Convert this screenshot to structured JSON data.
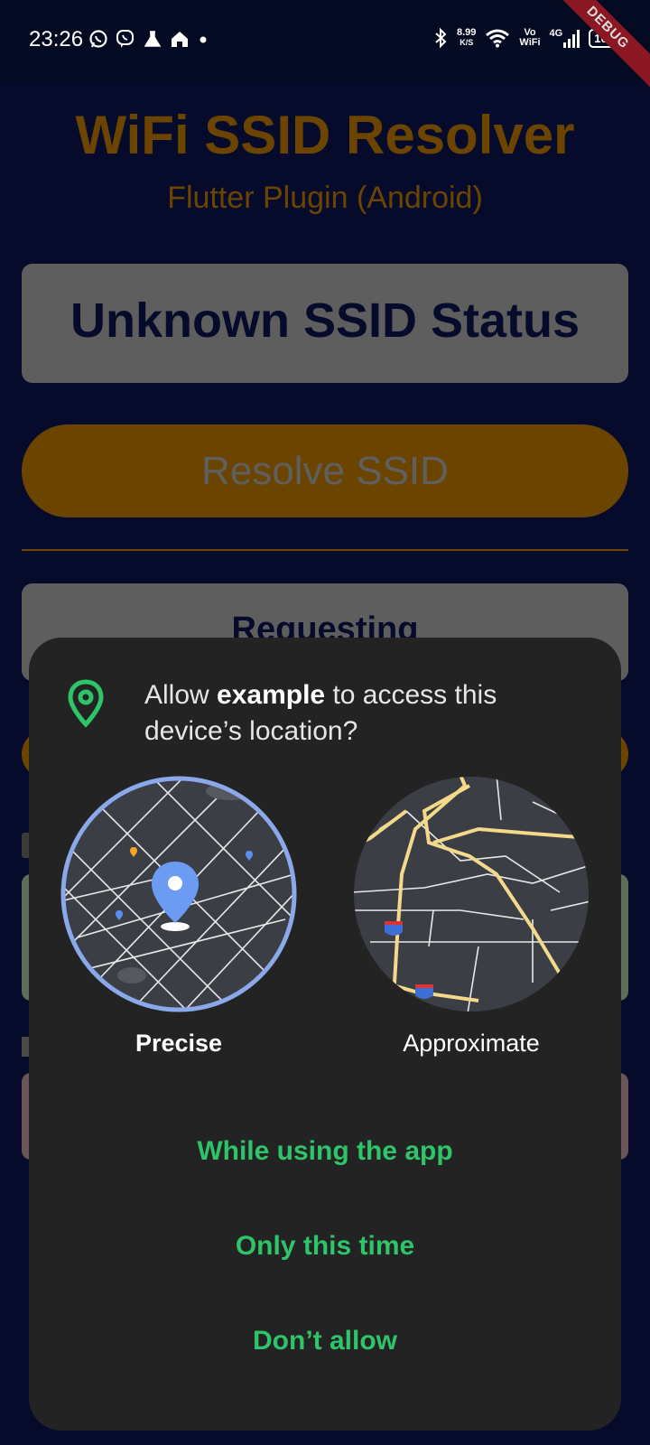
{
  "status_bar": {
    "time": "23:26",
    "left_icons": [
      "whatsapp-icon",
      "viber-icon",
      "lab-flask-icon",
      "home-icon",
      "dot-icon"
    ],
    "net_speed_value": "8.99",
    "net_speed_unit": "K/S",
    "vo_label": "Vo",
    "wifi_label": "WiFi",
    "network_label": "4G",
    "battery": "100",
    "debug_banner": "DEBUG"
  },
  "app": {
    "title": "WiFi SSID Resolver",
    "subtitle": "Flutter Plugin (Android)",
    "status_card_text": "Unknown SSID Status",
    "resolve_button_label": "Resolve SSID",
    "requesting_text": "Requesting",
    "colors": {
      "accent": "#ffa000",
      "background": "#060b2b"
    }
  },
  "dialog": {
    "message_prefix": "Allow ",
    "app_name": "example",
    "message_suffix": " to access this device’s location?",
    "precise_label": "Precise",
    "approximate_label": "Approximate",
    "option_while_using": "While using the app",
    "option_only_this_time": "Only this time",
    "option_dont_allow": "Don’t allow",
    "colors": {
      "accent": "#2ec46a",
      "surface": "#232323",
      "map_ring": "#8ba8ea"
    }
  }
}
